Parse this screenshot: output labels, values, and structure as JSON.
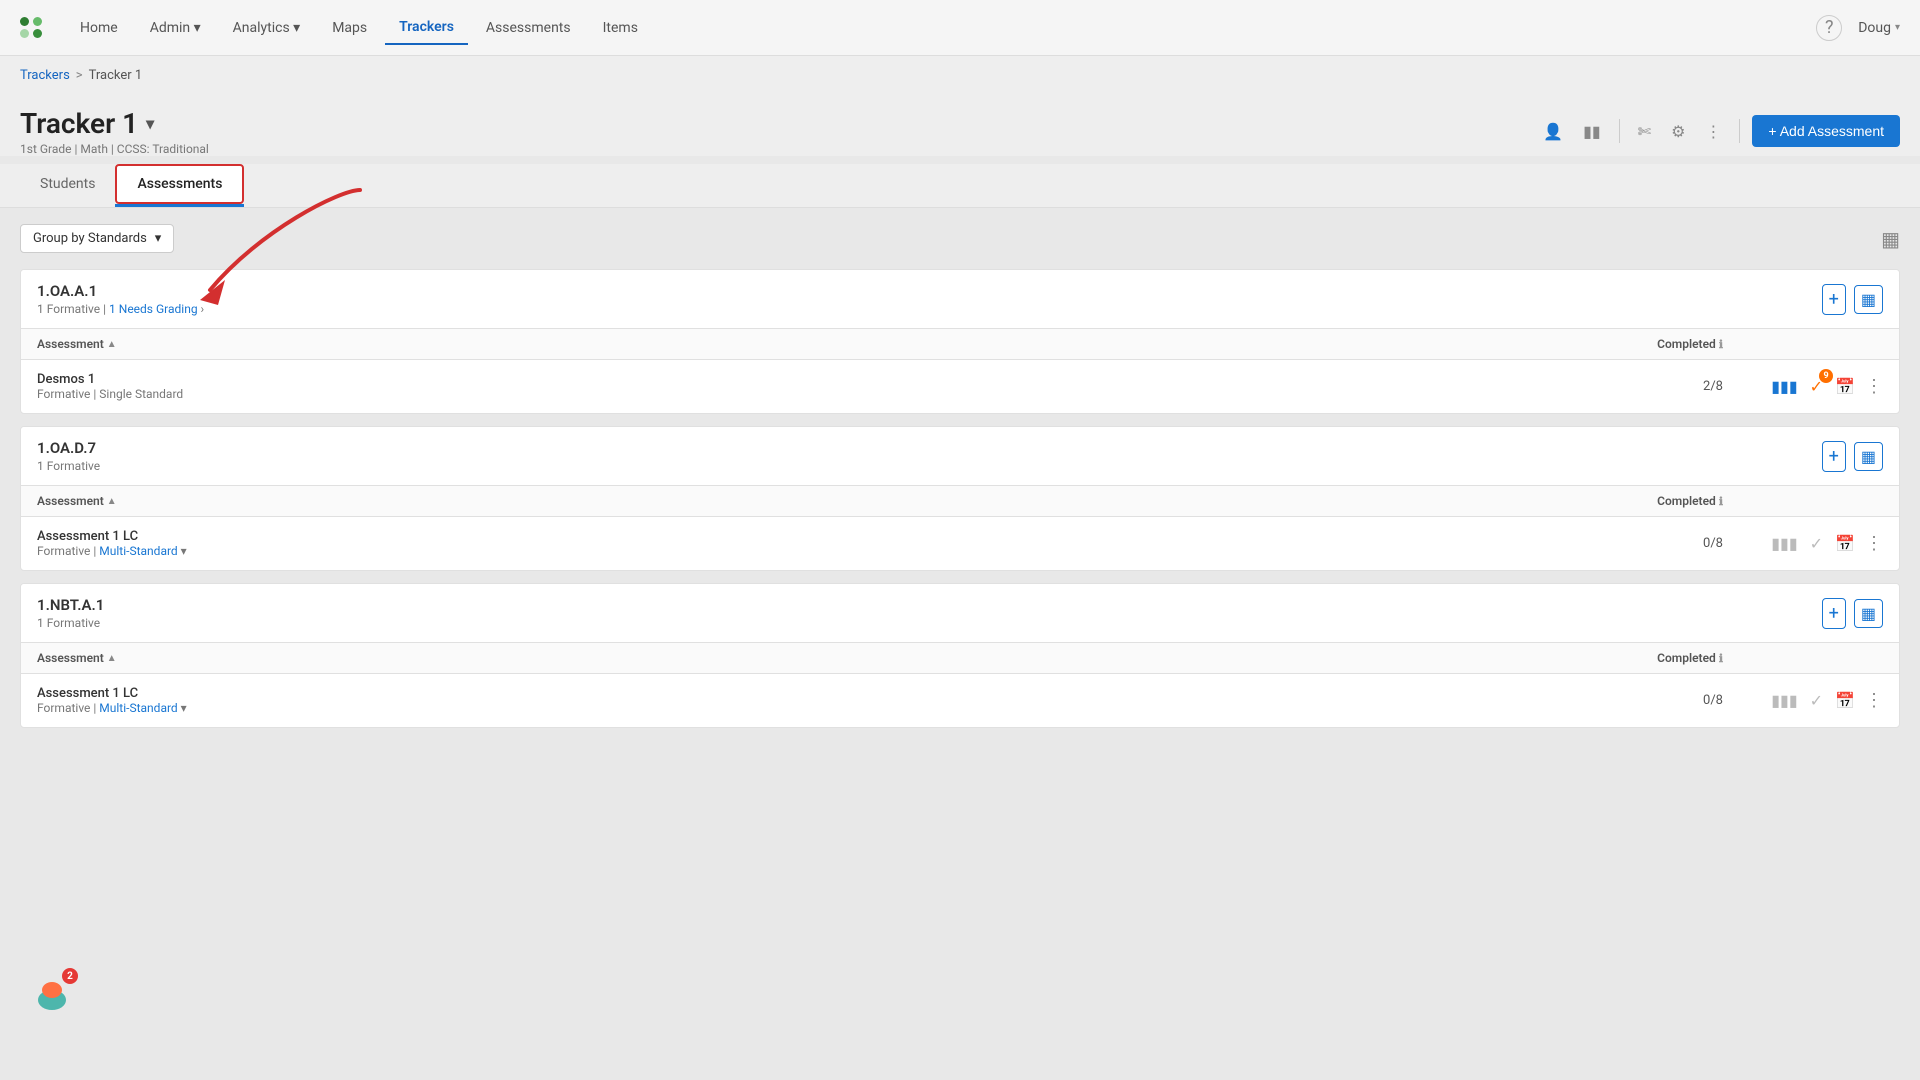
{
  "topbar": {
    "nav_items": [
      {
        "label": "Home",
        "id": "home",
        "active": false
      },
      {
        "label": "Admin",
        "id": "admin",
        "active": false,
        "has_dropdown": true
      },
      {
        "label": "Analytics",
        "id": "analytics",
        "active": false,
        "has_dropdown": true
      },
      {
        "label": "Maps",
        "id": "maps",
        "active": false
      },
      {
        "label": "Trackers",
        "id": "trackers",
        "active": true
      },
      {
        "label": "Assessments",
        "id": "assessments",
        "active": false
      },
      {
        "label": "Items",
        "id": "items",
        "active": false
      }
    ],
    "user_name": "Doug",
    "help_label": "?"
  },
  "breadcrumb": {
    "parent": "Trackers",
    "separator": ">",
    "current": "Tracker 1"
  },
  "page": {
    "title": "Tracker 1",
    "subtitle": "1st Grade | Math | CCSS: Traditional",
    "add_button_label": "+ Add Assessment"
  },
  "tabs": [
    {
      "label": "Students",
      "id": "students",
      "active": false
    },
    {
      "label": "Assessments",
      "id": "assessments",
      "active": true
    }
  ],
  "filter": {
    "group_by_label": "Group by Standards",
    "chevron": "▾"
  },
  "standards": [
    {
      "id": "1OAA1",
      "title": "1.OA.A.1",
      "subtitle_count": "1 Formative",
      "needs_grading": "1 Needs Grading",
      "assessments": [
        {
          "name": "Desmos 1",
          "type": "Formative | Single Standard",
          "completed": "2/8",
          "has_chart": true,
          "has_check_badge": true,
          "check_badge_color": "orange",
          "check_badge_count": "9"
        }
      ]
    },
    {
      "id": "1OAD7",
      "title": "1.OA.D.7",
      "subtitle_count": "1 Formative",
      "needs_grading": null,
      "assessments": [
        {
          "name": "Assessment 1 LC",
          "type": "Formative | Multi-Standard",
          "type_has_link": true,
          "completed": "0/8",
          "has_chart": true,
          "has_check_badge": false,
          "check_badge_color": null
        }
      ]
    },
    {
      "id": "1NBTA1",
      "title": "1.NBT.A.1",
      "subtitle_count": "1 Formative",
      "needs_grading": null,
      "assessments": [
        {
          "name": "Assessment 1 LC",
          "type": "Formative | Multi-Standard",
          "type_has_link": true,
          "completed": "0/8",
          "has_chart": true,
          "has_check_badge": false,
          "check_badge_color": null
        }
      ]
    }
  ],
  "column_headers": {
    "assessment": "Assessment",
    "completed": "Completed"
  },
  "floating_badge_count": "2"
}
